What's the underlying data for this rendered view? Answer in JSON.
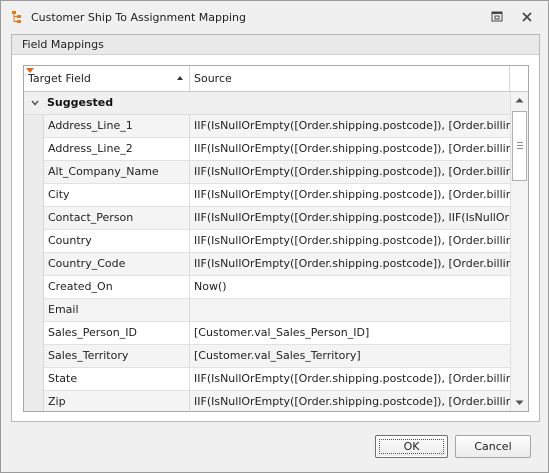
{
  "window": {
    "title": "Customer Ship To Assignment Mapping",
    "icons": {
      "app": "tree-mapping-icon",
      "restore": "restore-window-icon",
      "close": "close-icon"
    }
  },
  "group": {
    "label": "Field Mappings"
  },
  "grid": {
    "columns": {
      "target": "Target Field",
      "source": "Source"
    },
    "sort": {
      "column": "target",
      "direction": "ascending"
    },
    "filter_indicator": "filter-icon",
    "group_label": "Suggested",
    "rows": [
      {
        "target": "Address_Line_1",
        "source": "IIF(IsNullOrEmpty([Order.shipping.postcode]), [Order.billing.a..."
      },
      {
        "target": "Address_Line_2",
        "source": "IIF(IsNullOrEmpty([Order.shipping.postcode]), [Order.billing.a..."
      },
      {
        "target": "Alt_Company_Name",
        "source": "IIF(IsNullOrEmpty([Order.shipping.postcode]), [Order.billing.c..."
      },
      {
        "target": "City",
        "source": "IIF(IsNullOrEmpty([Order.shipping.postcode]), [Order.billing.ci..."
      },
      {
        "target": "Contact_Person",
        "source": "IIF(IsNullOrEmpty([Order.shipping.postcode]), IIF(IsNullOrEm..."
      },
      {
        "target": "Country",
        "source": "IIF(IsNullOrEmpty([Order.shipping.postcode]), [Order.billing.c..."
      },
      {
        "target": "Country_Code",
        "source": "IIF(IsNullOrEmpty([Order.shipping.postcode]), [Order.billing.c..."
      },
      {
        "target": "Created_On",
        "source": "Now()"
      },
      {
        "target": "Email",
        "source": ""
      },
      {
        "target": "Sales_Person_ID",
        "source": "[Customer.val_Sales_Person_ID]"
      },
      {
        "target": "Sales_Territory",
        "source": "[Customer.val_Sales_Territory]"
      },
      {
        "target": "State",
        "source": "IIF(IsNullOrEmpty([Order.shipping.postcode]), [Order.billing.st..."
      },
      {
        "target": "Zip",
        "source": "IIF(IsNullOrEmpty([Order.shipping.postcode]), [Order.billing.p..."
      }
    ]
  },
  "buttons": {
    "ok": "OK",
    "cancel": "Cancel"
  }
}
